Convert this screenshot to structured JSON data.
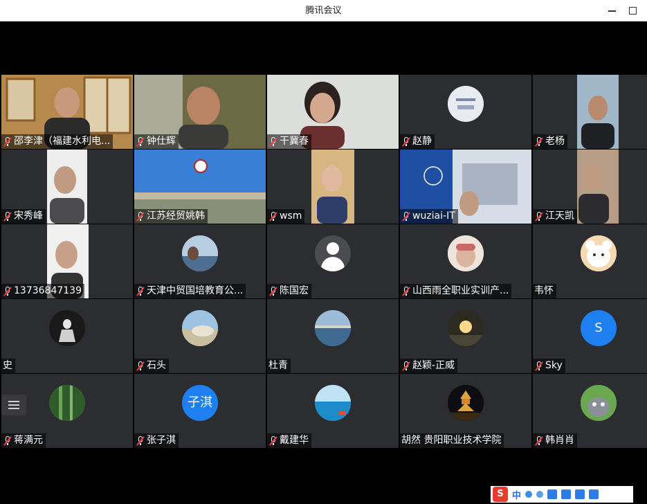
{
  "window": {
    "title": "腾讯会议"
  },
  "participants": [
    {
      "name": "邵李津（福建水利电...",
      "muted": true,
      "media": "video"
    },
    {
      "name": "钟仕辉",
      "muted": true,
      "media": "video"
    },
    {
      "name": "干冀春",
      "muted": true,
      "media": "video"
    },
    {
      "name": "赵静",
      "muted": true,
      "media": "avatar"
    },
    {
      "name": "老杨",
      "muted": true,
      "media": "video"
    },
    {
      "name": "宋秀峰",
      "muted": true,
      "media": "video"
    },
    {
      "name": "江苏经贸姚韩",
      "muted": true,
      "media": "video"
    },
    {
      "name": "wsm",
      "muted": true,
      "media": "video"
    },
    {
      "name": "wuziai-IT",
      "muted": true,
      "media": "video"
    },
    {
      "name": "江天凯",
      "muted": true,
      "media": "video"
    },
    {
      "name": "13736847139",
      "muted": true,
      "media": "video"
    },
    {
      "name": "天津中贸国培教育公...",
      "muted": true,
      "media": "avatar"
    },
    {
      "name": "陈国宏",
      "muted": true,
      "media": "default"
    },
    {
      "name": "山西雨全职业实训产...",
      "muted": true,
      "media": "avatar"
    },
    {
      "name": "韦怀",
      "muted": false,
      "media": "avatar"
    },
    {
      "name": "史",
      "muted": false,
      "media": "avatar"
    },
    {
      "name": "石头",
      "muted": true,
      "media": "avatar"
    },
    {
      "name": "杜青",
      "muted": false,
      "media": "avatar"
    },
    {
      "name": "赵颖-正威",
      "muted": true,
      "media": "avatar"
    },
    {
      "name": "Sky",
      "muted": true,
      "media": "letter",
      "avatar_text": "S"
    },
    {
      "name": "蒋满元",
      "muted": true,
      "media": "avatar"
    },
    {
      "name": "张子淇",
      "muted": true,
      "media": "letter",
      "avatar_text": "子淇"
    },
    {
      "name": "戴建华",
      "muted": true,
      "media": "avatar"
    },
    {
      "name": "胡然 贵阳职业技术学院",
      "muted": false,
      "media": "avatar"
    },
    {
      "name": "韩肖肖",
      "muted": true,
      "media": "avatar"
    }
  ],
  "ime": {
    "mode": "中"
  },
  "colors": {
    "tile_bg": "#2c2d31",
    "muted_mic": "#f23b3b",
    "letter_avatar": "#1e7ff0"
  }
}
